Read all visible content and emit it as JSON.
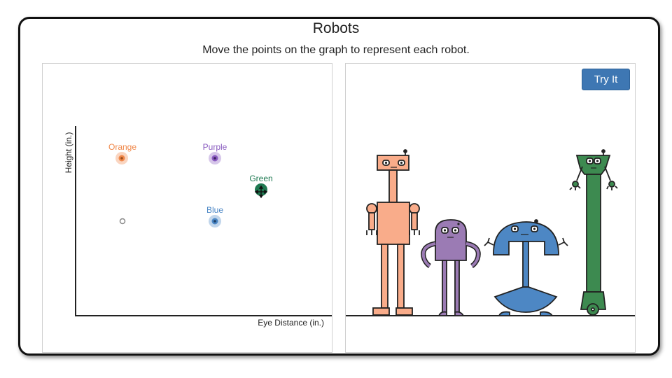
{
  "header": {
    "title": "Robots",
    "instructions": "Move the points on the graph to represent each robot."
  },
  "graph": {
    "x_axis_label": "Eye Distance (in.)",
    "y_axis_label": "Height (in.)",
    "points": [
      {
        "name": "Orange",
        "color": "#f0884a"
      },
      {
        "name": "Purple",
        "color": "#8a5cc0"
      },
      {
        "name": "Green",
        "color": "#1f7a52"
      },
      {
        "name": "Blue",
        "color": "#4a86c5"
      }
    ]
  },
  "buttons": {
    "try_it": "Try It"
  },
  "colors": {
    "orange_robot": "#f9ac8a",
    "purple_robot": "#9b7bb4",
    "blue_robot": "#4d87c4",
    "green_robot": "#3d8a50",
    "button": "#3e77b3"
  }
}
